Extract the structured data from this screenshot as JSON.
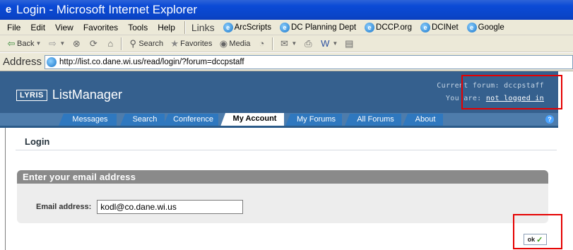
{
  "window": {
    "title": "Login - Microsoft Internet Explorer"
  },
  "menu": {
    "items": [
      "File",
      "Edit",
      "View",
      "Favorites",
      "Tools",
      "Help"
    ],
    "links_label": "Links",
    "links": [
      "ArcScripts",
      "DC Planning Dept",
      "DCCP.org",
      "DCINet",
      "Google"
    ]
  },
  "toolbar": {
    "back": "Back",
    "search": "Search",
    "favorites": "Favorites",
    "media": "Media"
  },
  "address": {
    "label": "Address",
    "url": "http://list.co.dane.wi.us/read/login/?forum=dccpstaff"
  },
  "header": {
    "logo": "LYRIS",
    "product": "ListManager",
    "current_forum": "Current forum: dccpstaff",
    "you_are": "You are:",
    "login_status": "not logged in"
  },
  "tabs": [
    {
      "label": "Messages",
      "active": false
    },
    {
      "label": "Search",
      "active": false
    },
    {
      "label": "Conference",
      "active": false
    },
    {
      "label": "My Account",
      "active": true
    },
    {
      "label": "My Forums",
      "active": false
    },
    {
      "label": "All Forums",
      "active": false
    },
    {
      "label": "About",
      "active": false
    }
  ],
  "help": "?",
  "page": {
    "title": "Login"
  },
  "form": {
    "section_title": "Enter your email address",
    "email_label": "Email address:",
    "email_value": "kodl@co.dane.wi.us"
  },
  "ok_button": "ok",
  "colors": {
    "highlight": "#e50000",
    "header": "#35608e",
    "tab": "#2f78bf",
    "check": "#3b9a1b"
  }
}
